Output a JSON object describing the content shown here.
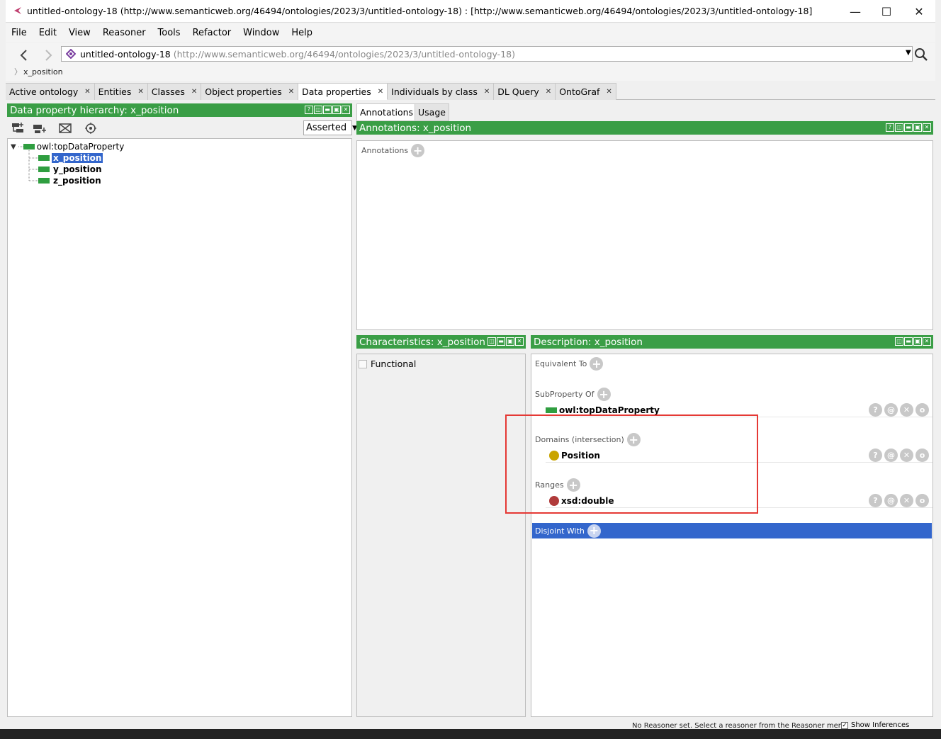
{
  "window": {
    "title": "untitled-ontology-18 (http://www.semanticweb.org/46494/ontologies/2023/3/untitled-ontology-18)  : [http://www.semanticweb.org/46494/ontologies/2023/3/untitled-ontology-18]",
    "minimize": "—",
    "maximize": "☐",
    "close": "✕"
  },
  "menu": [
    "File",
    "Edit",
    "View",
    "Reasoner",
    "Tools",
    "Refactor",
    "Window",
    "Help"
  ],
  "nav": {
    "ontology_name": "untitled-ontology-18",
    "ontology_uri": "(http://www.semanticweb.org/46494/ontologies/2023/3/untitled-ontology-18)",
    "breadcrumb": "x_position"
  },
  "tabs": [
    {
      "label": "Active ontology",
      "close": "✕"
    },
    {
      "label": "Entities",
      "close": "✕"
    },
    {
      "label": "Classes",
      "close": "✕"
    },
    {
      "label": "Object properties",
      "close": "✕"
    },
    {
      "label": "Data properties",
      "close": "✕"
    },
    {
      "label": "Individuals by class",
      "close": "✕"
    },
    {
      "label": "DL Query",
      "close": "✕"
    },
    {
      "label": "OntoGraf",
      "close": "✕"
    }
  ],
  "hierarchy": {
    "header": "Data property hierarchy: x_position",
    "mode": "Asserted",
    "root": "owl:topDataProperty",
    "children": [
      "x_position",
      "y_position",
      "z_position"
    ]
  },
  "right_tabs": [
    "Annotations",
    "Usage"
  ],
  "annotations": {
    "header": "Annotations: x_position",
    "label": "Annotations"
  },
  "characteristics": {
    "header": "Characteristics: x_position",
    "functional": "Functional"
  },
  "description": {
    "header": "Description: x_position",
    "equivalent_to": "Equivalent To",
    "subproperty_of": "SubProperty Of",
    "subproperty_value": "owl:topDataProperty",
    "domains": "Domains (intersection)",
    "domain_value": "Position",
    "ranges": "Ranges",
    "range_value": "xsd:double",
    "disjoint_with": "Disjoint With"
  },
  "row_buttons": [
    "?",
    "@",
    "✕",
    "o"
  ],
  "panel_buttons": [
    "?",
    "◫",
    "▬",
    "▣",
    "✕"
  ],
  "status": {
    "text": "No Reasoner set. Select a reasoner from the Reasoner menu",
    "show_inferences": "Show Inferences"
  },
  "colors": {
    "header_green": "#3a9e46",
    "selection_blue": "#3366cc",
    "highlight_red": "#e53935",
    "class_dot": "#c9a400",
    "datatype_dot": "#b03a3a"
  }
}
